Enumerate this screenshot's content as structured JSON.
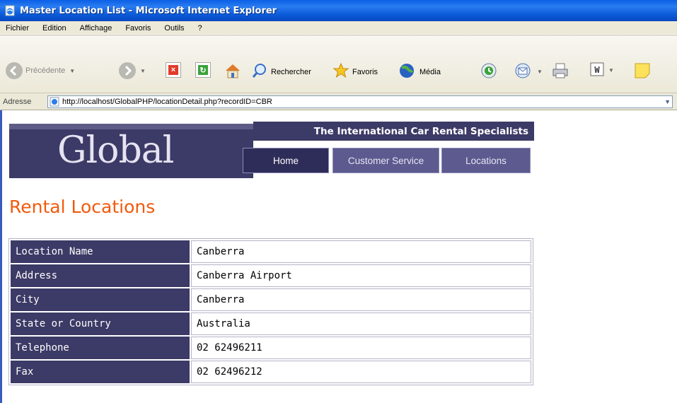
{
  "window": {
    "title": "Master Location List - Microsoft Internet Explorer"
  },
  "menu": [
    "Fichier",
    "Edition",
    "Affichage",
    "Favoris",
    "Outils",
    "?"
  ],
  "toolbar": {
    "back_label": "Précédente",
    "search_label": "Rechercher",
    "favorites_label": "Favoris",
    "media_label": "Média"
  },
  "address": {
    "label": "Adresse",
    "url": "http://localhost/GlobalPHP/locationDetail.php?recordID=CBR"
  },
  "site": {
    "logo_text": "Global",
    "tagline": "The International Car Rental Specialists",
    "nav": [
      "Home",
      "Customer Service",
      "Locations"
    ]
  },
  "page": {
    "title": "Rental Locations",
    "rows": [
      {
        "label": "Location Name",
        "value": "Canberra"
      },
      {
        "label": "Address",
        "value": "Canberra Airport"
      },
      {
        "label": "City",
        "value": "Canberra"
      },
      {
        "label": "State or Country",
        "value": "Australia"
      },
      {
        "label": "Telephone",
        "value": "02 62496211"
      },
      {
        "label": "Fax",
        "value": "02 62496212"
      }
    ]
  },
  "icons": {
    "title": "ie-page-icon",
    "back": "back-arrow-icon",
    "forward": "forward-arrow-icon",
    "stop": "stop-icon",
    "refresh": "refresh-icon",
    "home": "home-icon",
    "search": "search-icon",
    "favorites": "favorites-star-icon",
    "media": "media-globe-icon",
    "history": "history-icon",
    "mail": "mail-icon",
    "print": "print-icon",
    "word": "word-icon",
    "notes": "notes-icon"
  },
  "colors": {
    "titlebar": "#0a5fe6",
    "chrome": "#ece9d8",
    "header_purple": "#3c3a66",
    "title_orange": "#f25a0c"
  }
}
